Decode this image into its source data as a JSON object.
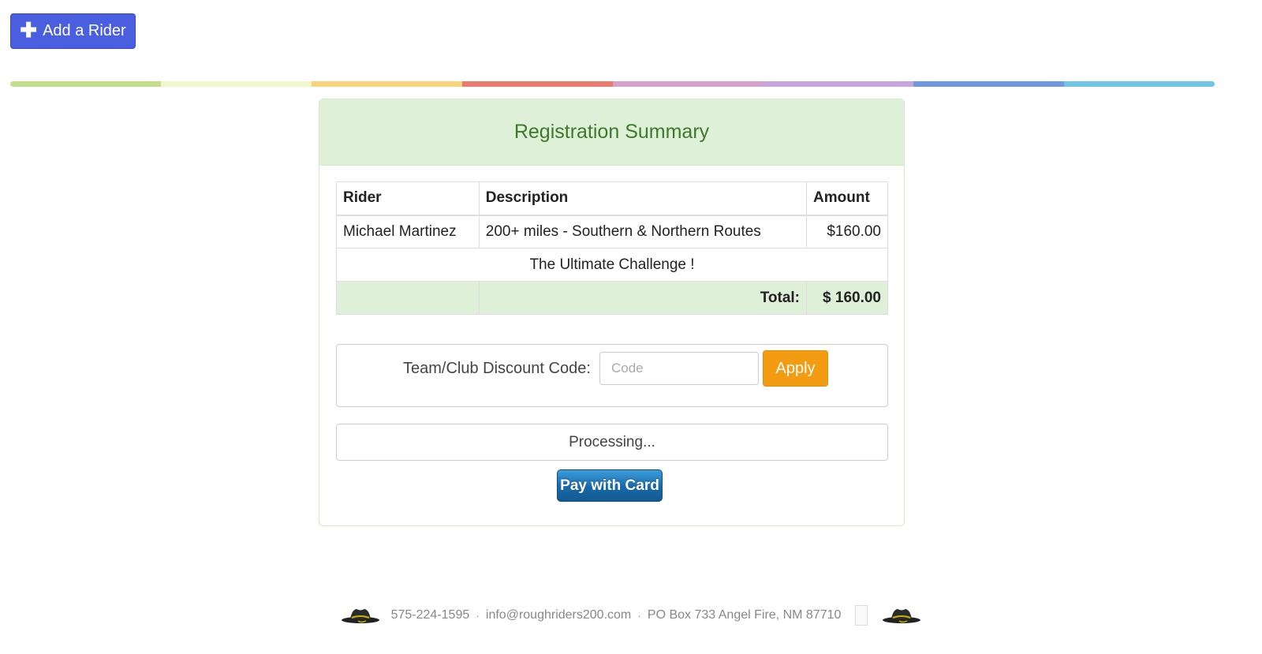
{
  "toolbar": {
    "add_rider_label": "Add a Rider"
  },
  "stripe_colors": [
    "#c4df8b",
    "#f2f7cb",
    "#f8d37c",
    "#ea7a6b",
    "#d7a2c9",
    "#c7a6e0",
    "#6f98e0",
    "#6ec6e2"
  ],
  "summary": {
    "title": "Registration Summary",
    "columns": [
      "Rider",
      "Description",
      "Amount"
    ],
    "rows": [
      {
        "rider": "Michael Martinez",
        "description": "200+ miles - Southern & Northern Routes",
        "amount": "$160.00"
      }
    ],
    "note": "The Ultimate Challenge !",
    "total_label": "Total:",
    "total_value": "$ 160.00"
  },
  "discount": {
    "label": "Team/Club Discount Code:",
    "placeholder": "Code",
    "apply_label": "Apply"
  },
  "payment": {
    "status": "Processing...",
    "pay_label": "Pay with Card"
  },
  "footer": {
    "phone": "575-224-1595",
    "email": "info@roughriders200.com",
    "address": "PO Box 733 Angel Fire, NM 87710",
    "separator": "·"
  },
  "colors": {
    "add_button": "#4a5ee0",
    "panel_heading_bg": "#dff0d8",
    "panel_heading_text": "#3c7a2a",
    "apply_button": "#f39c12",
    "pay_button": "#1868a8"
  }
}
